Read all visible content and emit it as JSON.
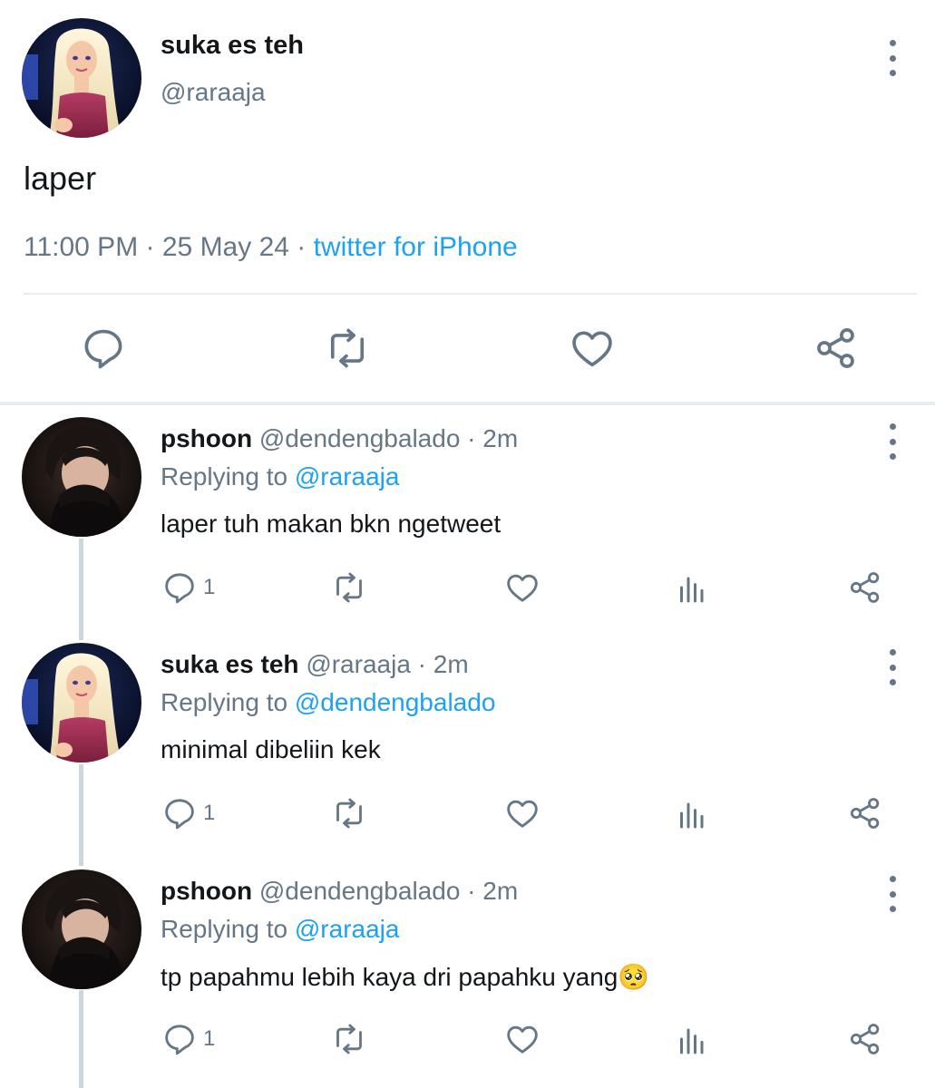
{
  "tweet": {
    "author_name": "suka es teh",
    "author_handle": "@raraaja",
    "text": "laper",
    "time": "11:00 PM",
    "date": "25 May 24",
    "source": "twitter for iPhone"
  },
  "replies": [
    {
      "name": "pshoon",
      "handle": "@dendengbalado",
      "age": "2m",
      "replying_label": "Replying to",
      "replying_to": "@raraaja",
      "text": "laper tuh makan bkn ngetweet",
      "reply_count": "1"
    },
    {
      "name": "suka es teh",
      "handle": "@raraaja",
      "age": "2m",
      "replying_label": "Replying to",
      "replying_to": "@dendengbalado",
      "text": "minimal dibeliin kek",
      "reply_count": "1"
    },
    {
      "name": "pshoon",
      "handle": "@dendengbalado",
      "age": "2m",
      "replying_label": "Replying to",
      "replying_to": "@raraaja",
      "text": "tp papahmu lebih kaya dri papahku yang",
      "emoji": "🥺",
      "reply_count": "1"
    }
  ],
  "colors": {
    "accent": "#1da1f2",
    "text_secondary": "#657786",
    "icon": "#657786",
    "divider": "#e6ecf0"
  },
  "icons": [
    "more-vertical-icon",
    "reply-icon",
    "retweet-icon",
    "like-icon",
    "share-icon",
    "analytics-icon",
    "pleading-face-emoji"
  ]
}
